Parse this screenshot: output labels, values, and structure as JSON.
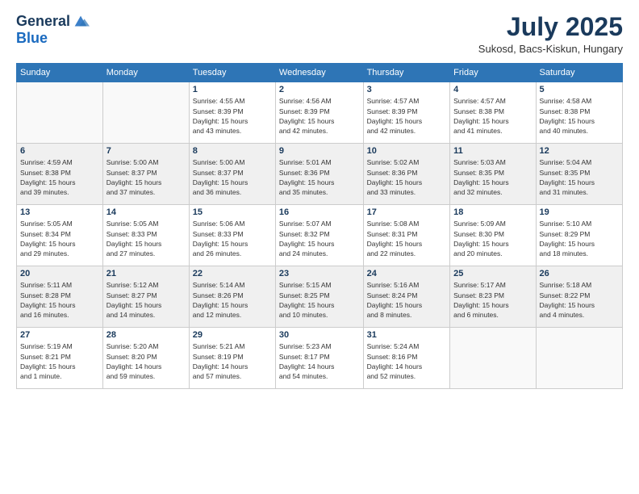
{
  "logo": {
    "line1": "General",
    "line2": "Blue"
  },
  "title": "July 2025",
  "subtitle": "Sukosd, Bacs-Kiskun, Hungary",
  "weekdays": [
    "Sunday",
    "Monday",
    "Tuesday",
    "Wednesday",
    "Thursday",
    "Friday",
    "Saturday"
  ],
  "weeks": [
    [
      {
        "day": "",
        "info": ""
      },
      {
        "day": "",
        "info": ""
      },
      {
        "day": "1",
        "info": "Sunrise: 4:55 AM\nSunset: 8:39 PM\nDaylight: 15 hours\nand 43 minutes."
      },
      {
        "day": "2",
        "info": "Sunrise: 4:56 AM\nSunset: 8:39 PM\nDaylight: 15 hours\nand 42 minutes."
      },
      {
        "day": "3",
        "info": "Sunrise: 4:57 AM\nSunset: 8:39 PM\nDaylight: 15 hours\nand 42 minutes."
      },
      {
        "day": "4",
        "info": "Sunrise: 4:57 AM\nSunset: 8:38 PM\nDaylight: 15 hours\nand 41 minutes."
      },
      {
        "day": "5",
        "info": "Sunrise: 4:58 AM\nSunset: 8:38 PM\nDaylight: 15 hours\nand 40 minutes."
      }
    ],
    [
      {
        "day": "6",
        "info": "Sunrise: 4:59 AM\nSunset: 8:38 PM\nDaylight: 15 hours\nand 39 minutes."
      },
      {
        "day": "7",
        "info": "Sunrise: 5:00 AM\nSunset: 8:37 PM\nDaylight: 15 hours\nand 37 minutes."
      },
      {
        "day": "8",
        "info": "Sunrise: 5:00 AM\nSunset: 8:37 PM\nDaylight: 15 hours\nand 36 minutes."
      },
      {
        "day": "9",
        "info": "Sunrise: 5:01 AM\nSunset: 8:36 PM\nDaylight: 15 hours\nand 35 minutes."
      },
      {
        "day": "10",
        "info": "Sunrise: 5:02 AM\nSunset: 8:36 PM\nDaylight: 15 hours\nand 33 minutes."
      },
      {
        "day": "11",
        "info": "Sunrise: 5:03 AM\nSunset: 8:35 PM\nDaylight: 15 hours\nand 32 minutes."
      },
      {
        "day": "12",
        "info": "Sunrise: 5:04 AM\nSunset: 8:35 PM\nDaylight: 15 hours\nand 31 minutes."
      }
    ],
    [
      {
        "day": "13",
        "info": "Sunrise: 5:05 AM\nSunset: 8:34 PM\nDaylight: 15 hours\nand 29 minutes."
      },
      {
        "day": "14",
        "info": "Sunrise: 5:05 AM\nSunset: 8:33 PM\nDaylight: 15 hours\nand 27 minutes."
      },
      {
        "day": "15",
        "info": "Sunrise: 5:06 AM\nSunset: 8:33 PM\nDaylight: 15 hours\nand 26 minutes."
      },
      {
        "day": "16",
        "info": "Sunrise: 5:07 AM\nSunset: 8:32 PM\nDaylight: 15 hours\nand 24 minutes."
      },
      {
        "day": "17",
        "info": "Sunrise: 5:08 AM\nSunset: 8:31 PM\nDaylight: 15 hours\nand 22 minutes."
      },
      {
        "day": "18",
        "info": "Sunrise: 5:09 AM\nSunset: 8:30 PM\nDaylight: 15 hours\nand 20 minutes."
      },
      {
        "day": "19",
        "info": "Sunrise: 5:10 AM\nSunset: 8:29 PM\nDaylight: 15 hours\nand 18 minutes."
      }
    ],
    [
      {
        "day": "20",
        "info": "Sunrise: 5:11 AM\nSunset: 8:28 PM\nDaylight: 15 hours\nand 16 minutes."
      },
      {
        "day": "21",
        "info": "Sunrise: 5:12 AM\nSunset: 8:27 PM\nDaylight: 15 hours\nand 14 minutes."
      },
      {
        "day": "22",
        "info": "Sunrise: 5:14 AM\nSunset: 8:26 PM\nDaylight: 15 hours\nand 12 minutes."
      },
      {
        "day": "23",
        "info": "Sunrise: 5:15 AM\nSunset: 8:25 PM\nDaylight: 15 hours\nand 10 minutes."
      },
      {
        "day": "24",
        "info": "Sunrise: 5:16 AM\nSunset: 8:24 PM\nDaylight: 15 hours\nand 8 minutes."
      },
      {
        "day": "25",
        "info": "Sunrise: 5:17 AM\nSunset: 8:23 PM\nDaylight: 15 hours\nand 6 minutes."
      },
      {
        "day": "26",
        "info": "Sunrise: 5:18 AM\nSunset: 8:22 PM\nDaylight: 15 hours\nand 4 minutes."
      }
    ],
    [
      {
        "day": "27",
        "info": "Sunrise: 5:19 AM\nSunset: 8:21 PM\nDaylight: 15 hours\nand 1 minute."
      },
      {
        "day": "28",
        "info": "Sunrise: 5:20 AM\nSunset: 8:20 PM\nDaylight: 14 hours\nand 59 minutes."
      },
      {
        "day": "29",
        "info": "Sunrise: 5:21 AM\nSunset: 8:19 PM\nDaylight: 14 hours\nand 57 minutes."
      },
      {
        "day": "30",
        "info": "Sunrise: 5:23 AM\nSunset: 8:17 PM\nDaylight: 14 hours\nand 54 minutes."
      },
      {
        "day": "31",
        "info": "Sunrise: 5:24 AM\nSunset: 8:16 PM\nDaylight: 14 hours\nand 52 minutes."
      },
      {
        "day": "",
        "info": ""
      },
      {
        "day": "",
        "info": ""
      }
    ]
  ]
}
